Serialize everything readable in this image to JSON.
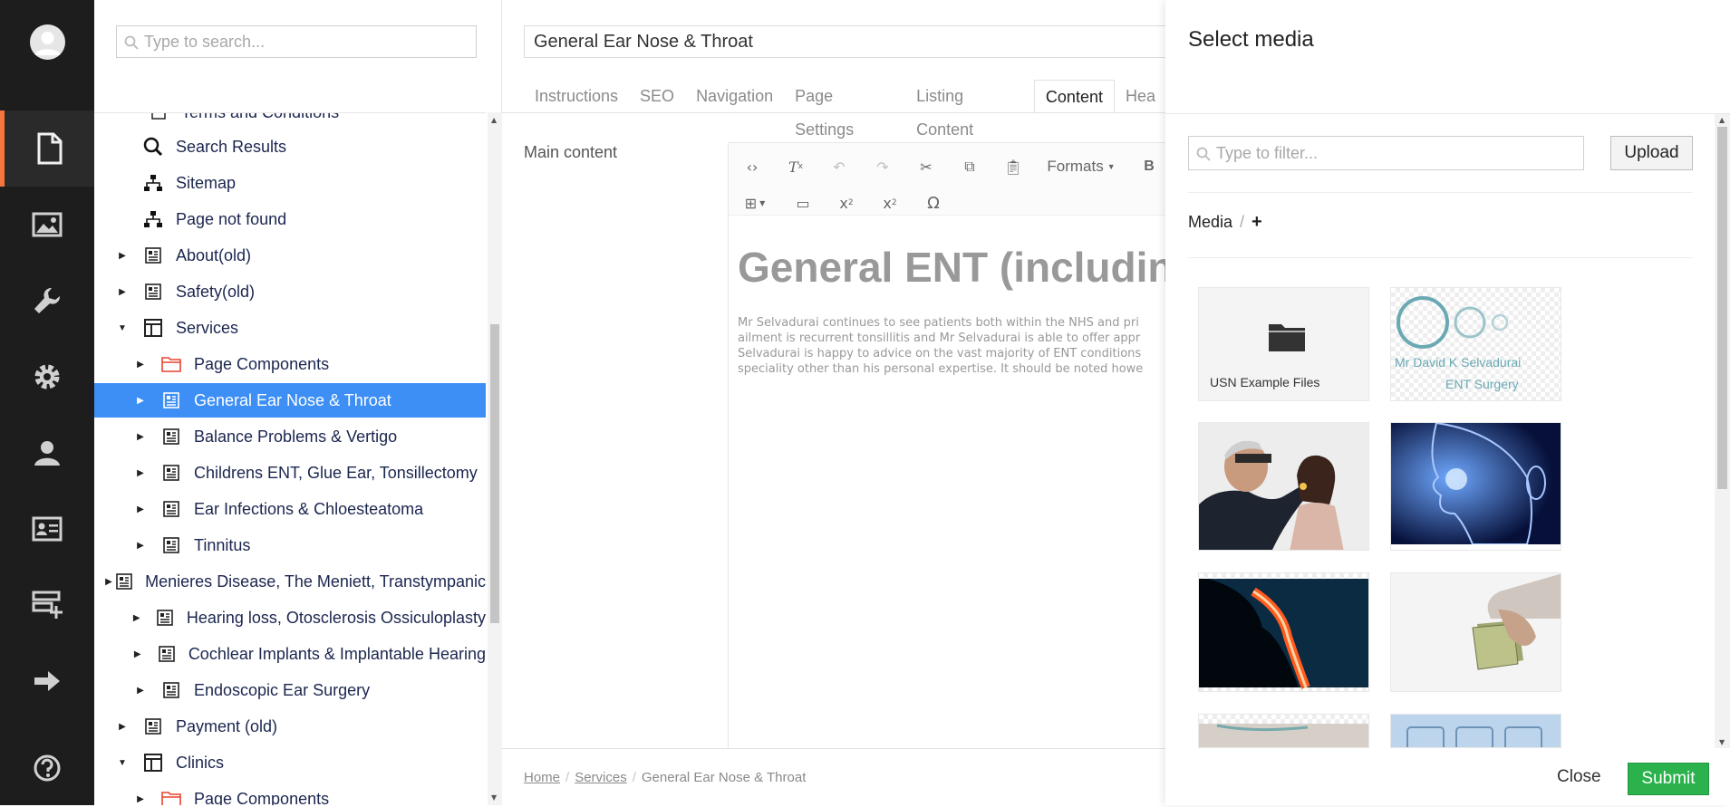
{
  "colors": {
    "accent": "#f5763d",
    "selected": "#3d8ff5",
    "submit": "#2bb24c",
    "sidebar": "#1d1d1d"
  },
  "sidebar": {
    "items": [
      {
        "name": "content",
        "icon": "document-icon"
      },
      {
        "name": "media",
        "icon": "image-icon"
      },
      {
        "name": "settings",
        "icon": "wrench-icon"
      },
      {
        "name": "developer",
        "icon": "gear-icon"
      },
      {
        "name": "users",
        "icon": "user-icon"
      },
      {
        "name": "members",
        "icon": "id-card-icon"
      },
      {
        "name": "forms",
        "icon": "forms-icon"
      },
      {
        "name": "redirects",
        "icon": "arrow-right-icon"
      },
      {
        "name": "help",
        "icon": "help-icon"
      }
    ]
  },
  "tree": {
    "search_placeholder": "Type to search...",
    "partial_top": "Terms and Conditions",
    "items": [
      {
        "label": "Search Results",
        "icon": "search-icon"
      },
      {
        "label": "Sitemap",
        "icon": "sitemap-icon"
      },
      {
        "label": "Page not found",
        "icon": "sitemap-icon"
      },
      {
        "label": "About(old)",
        "icon": "page-icon"
      },
      {
        "label": "Safety(old)",
        "icon": "page-icon"
      },
      {
        "label": "Services",
        "icon": "layout-icon"
      },
      {
        "label": "Page Components",
        "icon": "folder-icon"
      },
      {
        "label": "General Ear Nose & Throat",
        "icon": "page-icon"
      },
      {
        "label": "Balance Problems & Vertigo",
        "icon": "page-icon"
      },
      {
        "label": "Childrens ENT, Glue Ear, Tonsillectomy",
        "icon": "page-icon"
      },
      {
        "label": "Ear Infections & Chloesteatoma",
        "icon": "page-icon"
      },
      {
        "label": "Tinnitus",
        "icon": "page-icon"
      },
      {
        "label": "Menieres Disease, The Meniett, Transtympanic",
        "icon": "page-icon"
      },
      {
        "label": "Hearing loss, Otosclerosis Ossiculoplasty",
        "icon": "page-icon"
      },
      {
        "label": "Cochlear Implants & Implantable Hearing",
        "icon": "page-icon"
      },
      {
        "label": "Endoscopic Ear Surgery",
        "icon": "page-icon"
      },
      {
        "label": "Payment (old)",
        "icon": "page-icon"
      },
      {
        "label": "Clinics",
        "icon": "layout-icon"
      },
      {
        "label": "Page Components",
        "icon": "folder-icon"
      }
    ]
  },
  "editor": {
    "title": "General Ear Nose & Throat",
    "tabs": [
      "Instructions",
      "SEO",
      "Navigation",
      "Page Settings",
      "Listing Content",
      "Content",
      "Hea"
    ],
    "main_content_label": "Main content",
    "toolbar": {
      "formats_label": "Formats",
      "bold_label": "B",
      "special_char": "Ω"
    },
    "heading": "General ENT (including",
    "paragraph_lines": [
      "Mr Selvadurai continues to see patients both within the NHS and pri",
      "ailment is recurrent tonsillitis and Mr Selvadurai is able to offer appr",
      "Selvadurai is happy to advice on the vast majority of ENT conditions",
      "speciality other than his personal expertise. It should be noted howe"
    ],
    "breadcrumbs": [
      "Home",
      "Services",
      "General Ear Nose & Throat"
    ]
  },
  "media": {
    "title": "Select media",
    "filter_placeholder": "Type to filter...",
    "upload_label": "Upload",
    "crumb_root": "Media",
    "crumb_separator": "/",
    "crumb_add": "+",
    "folder_caption": "USN Example Files",
    "logo_line1": "Mr David K Selvadurai",
    "logo_line2": "ENT Surgery",
    "close_label": "Close",
    "submit_label": "Submit"
  }
}
